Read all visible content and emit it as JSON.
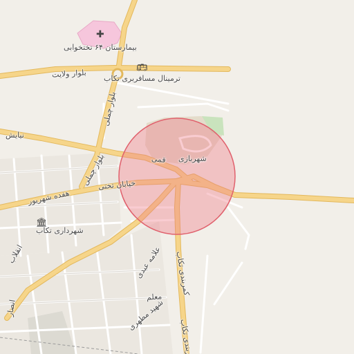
{
  "colors": {
    "background": "#f2efe9",
    "major_road": "#f6d58a",
    "major_road_casing": "#e3b85c",
    "minor_road": "#ffffff",
    "minor_road_casing": "#d7d3cc",
    "hospital_area": "#f6c6dc",
    "park_area": "#c9e3bd",
    "circle_fill": "#f08a94",
    "circle_stroke": "#e0606c"
  },
  "labels": {
    "hospital": "بیمارستان ۶۴ تختخوابی",
    "blvd_velayat": "بلوار ولایت",
    "bus_terminal": "ترمینال مسافربری تکاب",
    "blvd_chamli": "بلوار چملی",
    "niayesh": "نیایش",
    "shahrbazi": "شهربازی",
    "ghomi": "قمی",
    "takhti_street": "خیابان تختی",
    "hefdah_shahrivar": "هفده شهریور",
    "municipality": "شهرداری تکاب",
    "enghelab": "انقلاب",
    "allameh_abdi": "علامه عبدی",
    "takab_beltway": "کمربندی تکاب",
    "moallem": "معلم",
    "shahid_motahari": "شهید مطهری",
    "ansar": "انصار"
  },
  "icons": {
    "hospital": "hospital-cross-icon",
    "bus": "bus-icon",
    "municipality": "government-building-icon"
  }
}
